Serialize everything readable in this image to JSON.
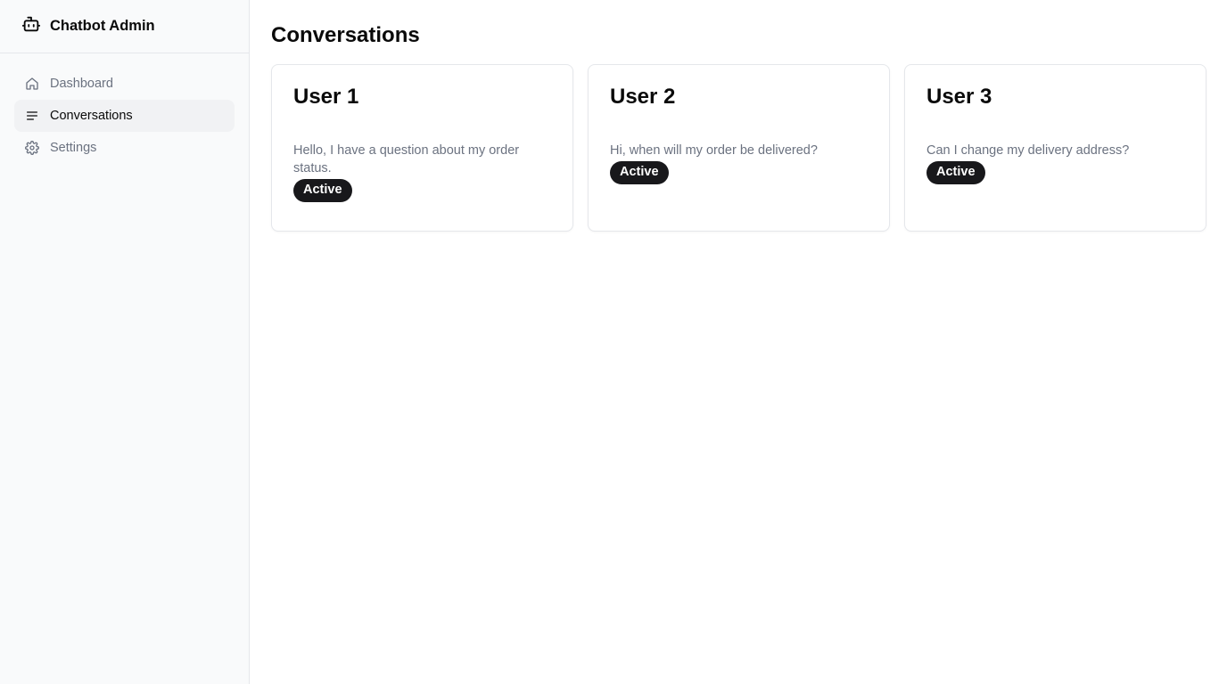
{
  "sidebar": {
    "brand": {
      "title": "Chatbot Admin",
      "icon": "bot-icon"
    },
    "items": [
      {
        "label": "Dashboard",
        "icon": "home-icon",
        "active": false
      },
      {
        "label": "Conversations",
        "icon": "list-icon",
        "active": true
      },
      {
        "label": "Settings",
        "icon": "gear-icon",
        "active": false
      }
    ]
  },
  "main": {
    "title": "Conversations",
    "conversations": [
      {
        "user": "User 1",
        "message": "Hello, I have a question about my order status.",
        "status": "Active"
      },
      {
        "user": "User 2",
        "message": "Hi, when will my order be delivered?",
        "status": "Active"
      },
      {
        "user": "User 3",
        "message": "Can I change my delivery address?",
        "status": "Active"
      }
    ]
  },
  "colors": {
    "badge_bg": "#18181b",
    "sidebar_bg": "#f9fafb",
    "active_item_bg": "#f1f2f4",
    "muted_text": "#6b7280"
  }
}
